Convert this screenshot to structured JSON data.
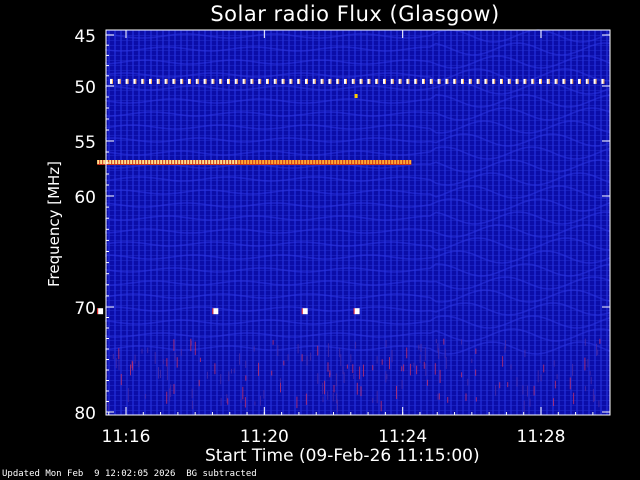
{
  "chart_data": {
    "type": "heatmap",
    "title": "Solar radio Flux (Glasgow)",
    "ylabel": "Frequency [MHz]",
    "xlabel": "Start Time (09-Feb-26 11:15:00)",
    "yticks": [
      "45",
      "50",
      "55",
      "60",
      "70",
      "80"
    ],
    "xticks": [
      "11:16",
      "11:20",
      "11:24",
      "11:28"
    ],
    "x_range_minutes": [
      11.25,
      11.5
    ],
    "features": [
      {
        "kind": "burst_band",
        "frequency_mhz": 57,
        "start": "11:15:10",
        "end": "11:24:15"
      },
      {
        "kind": "spike_line",
        "frequency_mhz": 49.6,
        "start": "11:15:00",
        "end": "11:30:00"
      },
      {
        "kind": "spike",
        "frequency_mhz": 70.4,
        "time": "11:15:15"
      },
      {
        "kind": "spike",
        "frequency_mhz": 70.4,
        "time": "11:18:35"
      },
      {
        "kind": "spike",
        "frequency_mhz": 70.4,
        "time": "11:21:10"
      },
      {
        "kind": "spike",
        "frequency_mhz": 70.4,
        "time": "11:22:40"
      },
      {
        "kind": "spike",
        "frequency_mhz": 51,
        "time": "11:22:40"
      }
    ]
  },
  "footer": {
    "updated": "Updated Mon Feb  9 12:02:05 2026",
    "note": "BG subtracted"
  },
  "colors": {
    "background": "#0b0da8",
    "stripe": "#2b34e0",
    "burst": "#ffaa33",
    "spike": "#ffffff"
  }
}
